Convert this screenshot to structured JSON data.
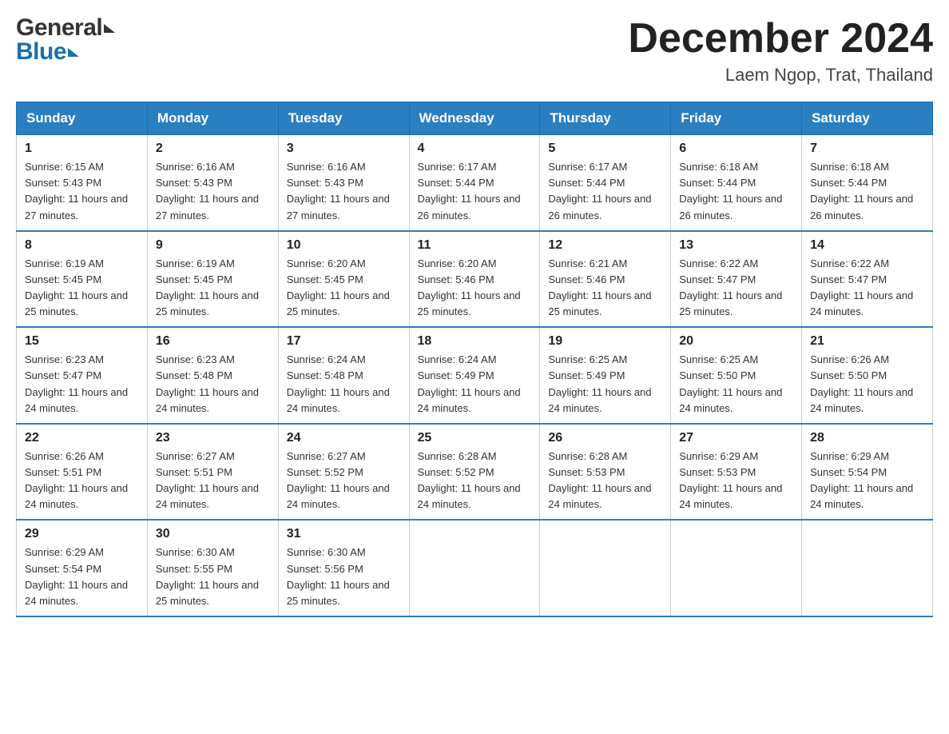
{
  "header": {
    "logo_general": "General",
    "logo_blue": "Blue",
    "month_title": "December 2024",
    "location": "Laem Ngop, Trat, Thailand"
  },
  "days_of_week": [
    "Sunday",
    "Monday",
    "Tuesday",
    "Wednesday",
    "Thursday",
    "Friday",
    "Saturday"
  ],
  "weeks": [
    [
      {
        "day": "1",
        "sunrise": "6:15 AM",
        "sunset": "5:43 PM",
        "daylight": "11 hours and 27 minutes."
      },
      {
        "day": "2",
        "sunrise": "6:16 AM",
        "sunset": "5:43 PM",
        "daylight": "11 hours and 27 minutes."
      },
      {
        "day": "3",
        "sunrise": "6:16 AM",
        "sunset": "5:43 PM",
        "daylight": "11 hours and 27 minutes."
      },
      {
        "day": "4",
        "sunrise": "6:17 AM",
        "sunset": "5:44 PM",
        "daylight": "11 hours and 26 minutes."
      },
      {
        "day": "5",
        "sunrise": "6:17 AM",
        "sunset": "5:44 PM",
        "daylight": "11 hours and 26 minutes."
      },
      {
        "day": "6",
        "sunrise": "6:18 AM",
        "sunset": "5:44 PM",
        "daylight": "11 hours and 26 minutes."
      },
      {
        "day": "7",
        "sunrise": "6:18 AM",
        "sunset": "5:44 PM",
        "daylight": "11 hours and 26 minutes."
      }
    ],
    [
      {
        "day": "8",
        "sunrise": "6:19 AM",
        "sunset": "5:45 PM",
        "daylight": "11 hours and 25 minutes."
      },
      {
        "day": "9",
        "sunrise": "6:19 AM",
        "sunset": "5:45 PM",
        "daylight": "11 hours and 25 minutes."
      },
      {
        "day": "10",
        "sunrise": "6:20 AM",
        "sunset": "5:45 PM",
        "daylight": "11 hours and 25 minutes."
      },
      {
        "day": "11",
        "sunrise": "6:20 AM",
        "sunset": "5:46 PM",
        "daylight": "11 hours and 25 minutes."
      },
      {
        "day": "12",
        "sunrise": "6:21 AM",
        "sunset": "5:46 PM",
        "daylight": "11 hours and 25 minutes."
      },
      {
        "day": "13",
        "sunrise": "6:22 AM",
        "sunset": "5:47 PM",
        "daylight": "11 hours and 25 minutes."
      },
      {
        "day": "14",
        "sunrise": "6:22 AM",
        "sunset": "5:47 PM",
        "daylight": "11 hours and 24 minutes."
      }
    ],
    [
      {
        "day": "15",
        "sunrise": "6:23 AM",
        "sunset": "5:47 PM",
        "daylight": "11 hours and 24 minutes."
      },
      {
        "day": "16",
        "sunrise": "6:23 AM",
        "sunset": "5:48 PM",
        "daylight": "11 hours and 24 minutes."
      },
      {
        "day": "17",
        "sunrise": "6:24 AM",
        "sunset": "5:48 PM",
        "daylight": "11 hours and 24 minutes."
      },
      {
        "day": "18",
        "sunrise": "6:24 AM",
        "sunset": "5:49 PM",
        "daylight": "11 hours and 24 minutes."
      },
      {
        "day": "19",
        "sunrise": "6:25 AM",
        "sunset": "5:49 PM",
        "daylight": "11 hours and 24 minutes."
      },
      {
        "day": "20",
        "sunrise": "6:25 AM",
        "sunset": "5:50 PM",
        "daylight": "11 hours and 24 minutes."
      },
      {
        "day": "21",
        "sunrise": "6:26 AM",
        "sunset": "5:50 PM",
        "daylight": "11 hours and 24 minutes."
      }
    ],
    [
      {
        "day": "22",
        "sunrise": "6:26 AM",
        "sunset": "5:51 PM",
        "daylight": "11 hours and 24 minutes."
      },
      {
        "day": "23",
        "sunrise": "6:27 AM",
        "sunset": "5:51 PM",
        "daylight": "11 hours and 24 minutes."
      },
      {
        "day": "24",
        "sunrise": "6:27 AM",
        "sunset": "5:52 PM",
        "daylight": "11 hours and 24 minutes."
      },
      {
        "day": "25",
        "sunrise": "6:28 AM",
        "sunset": "5:52 PM",
        "daylight": "11 hours and 24 minutes."
      },
      {
        "day": "26",
        "sunrise": "6:28 AM",
        "sunset": "5:53 PM",
        "daylight": "11 hours and 24 minutes."
      },
      {
        "day": "27",
        "sunrise": "6:29 AM",
        "sunset": "5:53 PM",
        "daylight": "11 hours and 24 minutes."
      },
      {
        "day": "28",
        "sunrise": "6:29 AM",
        "sunset": "5:54 PM",
        "daylight": "11 hours and 24 minutes."
      }
    ],
    [
      {
        "day": "29",
        "sunrise": "6:29 AM",
        "sunset": "5:54 PM",
        "daylight": "11 hours and 24 minutes."
      },
      {
        "day": "30",
        "sunrise": "6:30 AM",
        "sunset": "5:55 PM",
        "daylight": "11 hours and 25 minutes."
      },
      {
        "day": "31",
        "sunrise": "6:30 AM",
        "sunset": "5:56 PM",
        "daylight": "11 hours and 25 minutes."
      },
      null,
      null,
      null,
      null
    ]
  ]
}
